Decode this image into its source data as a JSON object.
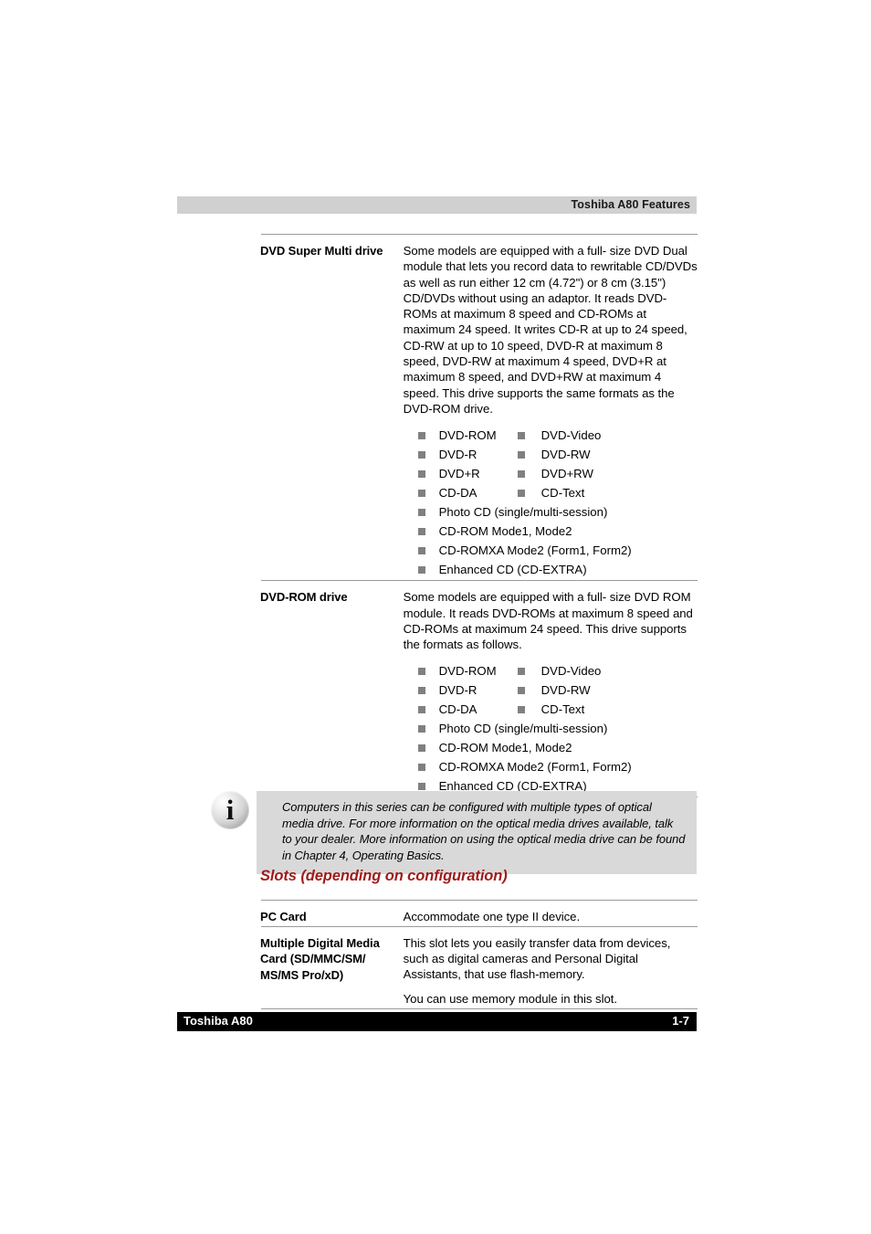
{
  "header": {
    "title": "Toshiba A80 Features"
  },
  "footer": {
    "left": "Toshiba A80",
    "page_number": "1-7"
  },
  "colors": {
    "heading_red": "#9e1b1b",
    "header_bar_gray": "#d0d0d0",
    "note_bg_gray": "#d9d9d9",
    "bullet_gray": "#808080",
    "footer_black": "#000000"
  },
  "optical_table": {
    "rows": [
      {
        "term": "DVD Super Multi drive",
        "description": "Some models are equipped with a full- size DVD Dual module that lets you record data to rewritable CD/DVDs as well as run either 12 cm (4.72\") or 8 cm (3.15\") CD/DVDs without using an adaptor. It reads DVD-ROMs at maximum 8 speed and CD-ROMs at maximum 24 speed. It writes CD-R at up to 24 speed, CD-RW at up to 10 speed, DVD-R at maximum 8 speed, DVD-RW at maximum 4 speed, DVD+R at maximum 8 speed, and DVD+RW at maximum 4 speed. This drive supports the same formats as the DVD-ROM drive.",
        "formats": [
          {
            "left": "DVD-ROM",
            "right": "DVD-Video"
          },
          {
            "left": "DVD-R",
            "right": "DVD-RW"
          },
          {
            "left": "DVD+R",
            "right": "DVD+RW"
          },
          {
            "left": "CD-DA",
            "right": "CD-Text"
          },
          {
            "left": "Photo CD (single/multi-session)",
            "right": ""
          },
          {
            "left": "CD-ROM Mode1, Mode2",
            "right": ""
          },
          {
            "left": "CD-ROMXA Mode2 (Form1, Form2)",
            "right": ""
          },
          {
            "left": "Enhanced CD (CD-EXTRA)",
            "right": ""
          }
        ]
      },
      {
        "term": "DVD-ROM drive",
        "description": "Some models are equipped with a full- size DVD ROM module. It reads DVD-ROMs at maximum 8 speed and CD-ROMs at maximum 24 speed. This drive supports the formats as follows.",
        "formats": [
          {
            "left": "DVD-ROM",
            "right": "DVD-Video"
          },
          {
            "left": "DVD-R",
            "right": "DVD-RW"
          },
          {
            "left": "CD-DA",
            "right": "CD-Text"
          },
          {
            "left": "Photo CD (single/multi-session)",
            "right": ""
          },
          {
            "left": "CD-ROM Mode1, Mode2",
            "right": ""
          },
          {
            "left": "CD-ROMXA Mode2 (Form1, Form2)",
            "right": ""
          },
          {
            "left": "Enhanced CD (CD-EXTRA)",
            "right": ""
          }
        ]
      }
    ]
  },
  "note": {
    "icon": "info-icon",
    "glyph": "i",
    "text": "Computers in this series can be configured with multiple types of optical media drive. For more information on the optical media drives available, talk to your dealer. More information on using the optical media drive can be found in Chapter 4, Operating Basics."
  },
  "slots_section": {
    "heading": "Slots (depending on configuration)",
    "rows": [
      {
        "term": "PC Card",
        "paragraphs": [
          "Accommodate one type II device."
        ]
      },
      {
        "term": "Multiple Digital Media Card (SD/MMC/SM/ MS/MS Pro/xD)",
        "paragraphs": [
          "This slot lets you easily transfer data from devices, such as digital cameras and Personal Digital Assistants, that use flash-memory.",
          "You can use memory module in this slot."
        ]
      }
    ]
  }
}
